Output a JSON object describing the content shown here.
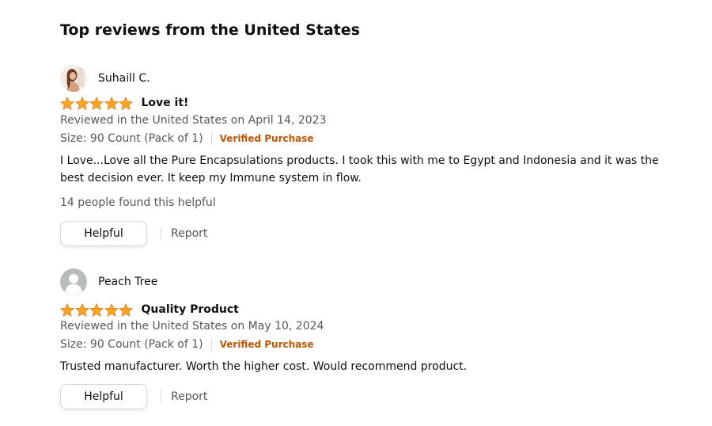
{
  "section_title": "Top reviews from the United States",
  "colors": {
    "star": "#ffa41c",
    "verified": "#c45500",
    "muted": "#565959"
  },
  "reviews": [
    {
      "profile_name": "Suhaill C.",
      "avatar_icon": "profile-photo",
      "stars": 5,
      "title": "Love it!",
      "date_line": "Reviewed in the United States on April 14, 2023",
      "format": "Size: 90 Count (Pack of 1)",
      "verified": "Verified Purchase",
      "body": "I Love...Love all the Pure Encapsulations products. I took this with me to Egypt and Indonesia and it was the best decision ever. It keep my Immune system in flow.",
      "helpful_count": "14 people found this helpful",
      "helpful_label": "Helpful",
      "report_label": "Report"
    },
    {
      "profile_name": "Peach Tree",
      "avatar_icon": "default-avatar-icon",
      "stars": 5,
      "title": "Quality Product",
      "date_line": "Reviewed in the United States on May 10, 2024",
      "format": "Size: 90 Count (Pack of 1)",
      "verified": "Verified Purchase",
      "body": "Trusted manufacturer. Worth the higher cost. Would recommend product.",
      "helpful_label": "Helpful",
      "report_label": "Report"
    }
  ]
}
